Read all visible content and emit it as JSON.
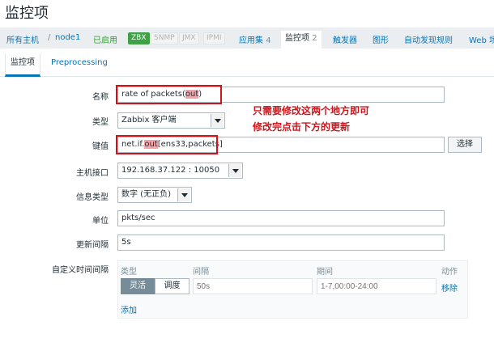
{
  "page": {
    "title": "监控项"
  },
  "breadcrumb": {
    "all_hosts": "所有主机",
    "separator": "/",
    "host": "node1",
    "status": "已启用",
    "tags": [
      "ZBX",
      "SNMP",
      "JMX",
      "IPMI"
    ],
    "links": [
      {
        "label": "应用集",
        "count": "4"
      },
      {
        "label": "监控项",
        "count": "2"
      },
      {
        "label": "触发器",
        "count": ""
      },
      {
        "label": "图形",
        "count": ""
      },
      {
        "label": "自动发现规则",
        "count": ""
      },
      {
        "label": "Web 场",
        "count": ""
      }
    ]
  },
  "tabs": [
    "监控项",
    "Preprocessing"
  ],
  "form": {
    "name": {
      "label": "名称",
      "value_prefix": "rate of packets(",
      "value_hl": "out",
      "value_suffix": ")"
    },
    "type": {
      "label": "类型",
      "value": "Zabbix 客户端"
    },
    "key": {
      "label": "键值",
      "value_prefix": "net.if.",
      "value_hl": "out",
      "value_suffix": "[ens33,packets]",
      "select_button": "选择"
    },
    "interface": {
      "label": "主机接口",
      "value": "192.168.37.122 : 10050"
    },
    "info_type": {
      "label": "信息类型",
      "value": "数字 (无正负)"
    },
    "units": {
      "label": "单位",
      "value": "pkts/sec"
    },
    "interval": {
      "label": "更新间隔",
      "value": "5s"
    },
    "custom_intervals": {
      "label": "自定义时间间隔",
      "headers": {
        "type": "类型",
        "interval": "间隔",
        "period": "期间",
        "action": "动作"
      },
      "row": {
        "flexible": "灵活",
        "scheduling": "调度",
        "interval_placeholder": "50s",
        "period_placeholder": "1-7,00:00-24:00",
        "remove": "移除"
      },
      "add": "添加"
    }
  },
  "annotation": {
    "line1": "只需要修改这两个地方即可",
    "line2": "修改完点击下方的更新"
  },
  "colors": {
    "accent": "#0275b8",
    "annotation": "#d0141b",
    "highlight": "#f5a3a8",
    "zbx_green": "#3fa146"
  }
}
